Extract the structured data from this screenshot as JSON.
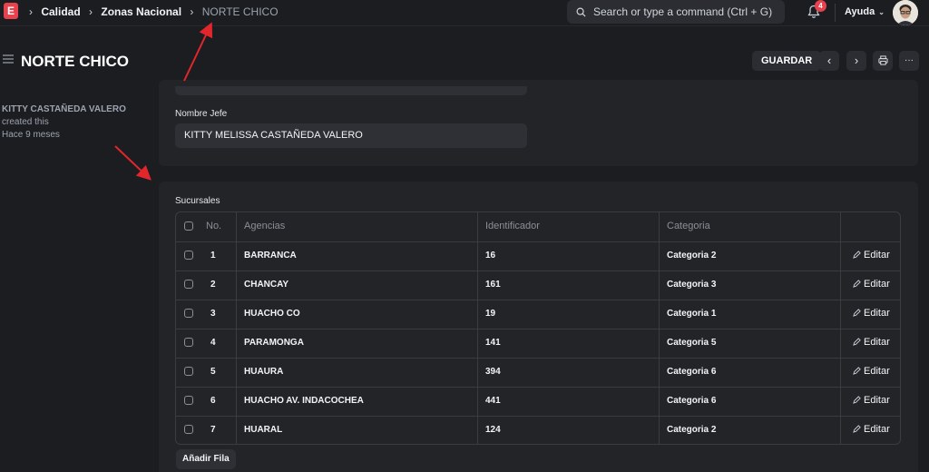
{
  "app": {
    "logo_letter": "E"
  },
  "breadcrumbs": [
    "Calidad",
    "Zonas Nacional",
    "NORTE CHICO"
  ],
  "search": {
    "placeholder": "Search or type a command (Ctrl + G)"
  },
  "notifications": {
    "count": "4"
  },
  "help": {
    "label": "Ayuda"
  },
  "page": {
    "title": "NORTE CHICO"
  },
  "toolbar": {
    "save_label": "GUARDAR",
    "more_label": "···"
  },
  "sidebar_meta": {
    "name": "KITTY CASTAÑEDA VALERO",
    "action": "created this",
    "time": "Hace 9 meses"
  },
  "form": {
    "jefe_label": "Nombre Jefe",
    "jefe_value": "KITTY MELISSA CASTAÑEDA VALERO"
  },
  "table": {
    "section_label": "Sucursales",
    "columns": [
      "No.",
      "Agencias",
      "Identificador",
      "Categoria"
    ],
    "edit_label": "Editar",
    "rows": [
      {
        "no": "1",
        "agencia": "BARRANCA",
        "id": "16",
        "categoria": "Categoria 2"
      },
      {
        "no": "2",
        "agencia": "CHANCAY",
        "id": "161",
        "categoria": "Categoria 3"
      },
      {
        "no": "3",
        "agencia": "HUACHO CO",
        "id": "19",
        "categoria": "Categoria 1"
      },
      {
        "no": "4",
        "agencia": "PARAMONGA",
        "id": "141",
        "categoria": "Categoria 5"
      },
      {
        "no": "5",
        "agencia": "HUAURA",
        "id": "394",
        "categoria": "Categoria 6"
      },
      {
        "no": "6",
        "agencia": "HUACHO AV. INDACOCHEA",
        "id": "441",
        "categoria": "Categoria 6"
      },
      {
        "no": "7",
        "agencia": "HUARAL",
        "id": "124",
        "categoria": "Categoria 2"
      }
    ],
    "add_row_label": "Añadir Fila"
  },
  "colors": {
    "accent": "#e7424d",
    "background": "#1c1d21",
    "card": "#232428",
    "annotation_arrow": "#e3262b"
  }
}
